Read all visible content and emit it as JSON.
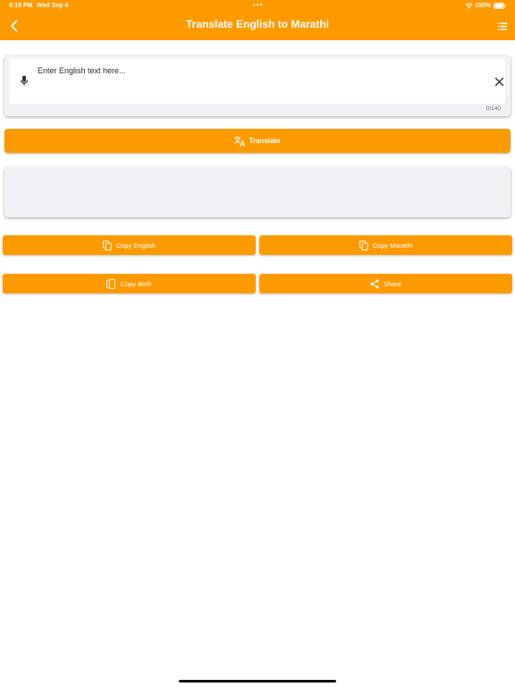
{
  "status_bar": {
    "time": "6:19 PM",
    "date": "Wed Sep 4",
    "center_dots": "•••",
    "battery": "100%"
  },
  "header": {
    "title": "Translate English to Marathi",
    "back_icon": "chevron-left-icon",
    "menu_icon": "list-icon"
  },
  "input": {
    "placeholder": "Enter English text here...",
    "value": "",
    "counter": "0/140",
    "mic_icon": "microphone-icon",
    "clear_icon": "close-icon"
  },
  "translate_button": {
    "label": "Translate",
    "icon": "translate-icon"
  },
  "output": {
    "text": ""
  },
  "actions": {
    "copy_english": "Copy English",
    "copy_marathi": "Copy Marathi",
    "copy_both": "Copy Both",
    "share": "Share"
  },
  "colors": {
    "accent": "#fd9a00",
    "card_bg": "#f3f1f6",
    "text_on_accent": "#ffffff"
  }
}
